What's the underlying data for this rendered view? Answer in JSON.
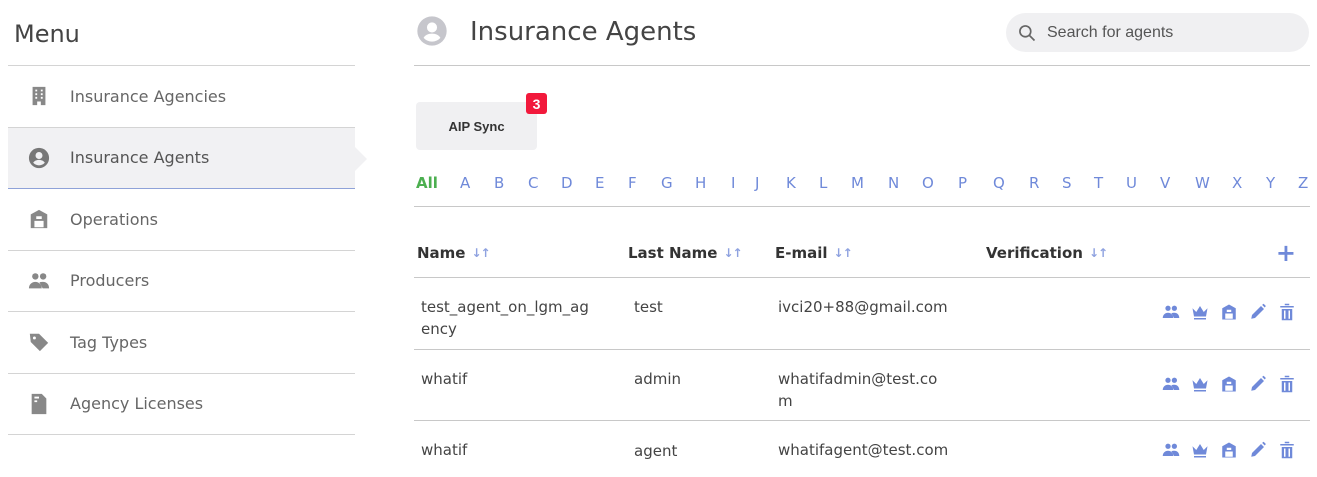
{
  "sidebar": {
    "title": "Menu",
    "items": [
      {
        "label": "Insurance Agencies",
        "icon": "building-icon"
      },
      {
        "label": "Insurance Agents",
        "icon": "user-circle-icon"
      },
      {
        "label": "Operations",
        "icon": "barn-icon"
      },
      {
        "label": "Producers",
        "icon": "users-icon"
      },
      {
        "label": "Tag Types",
        "icon": "tag-icon"
      },
      {
        "label": "Agency Licenses",
        "icon": "license-file-icon"
      }
    ],
    "active_index": 1
  },
  "header": {
    "title": "Insurance Agents",
    "search_placeholder": "Search for agents"
  },
  "sync": {
    "label": "AIP Sync",
    "badge": "3"
  },
  "alphabet": [
    "All",
    "A",
    "B",
    "C",
    "D",
    "E",
    "F",
    "G",
    "H",
    "I",
    "J",
    "K",
    "L",
    "M",
    "N",
    "O",
    "P",
    "Q",
    "R",
    "S",
    "T",
    "U",
    "V",
    "W",
    "X",
    "Y",
    "Z"
  ],
  "table": {
    "columns": [
      "Name",
      "Last Name",
      "E-mail",
      "Verification"
    ],
    "add_label": "+",
    "rows": [
      {
        "name": "test_agent_on_lgm_ag",
        "name2": "ency",
        "last_name": "test",
        "email": "ivci20+88@gmail.com",
        "email2": "",
        "verification": ""
      },
      {
        "name": "whatif",
        "name2": "",
        "last_name": "admin",
        "email": "whatifadmin@test.co",
        "email2": "m",
        "verification": ""
      },
      {
        "name": "whatif",
        "name2": "",
        "last_name": "agent",
        "email": "whatifagent@test.com",
        "email2": "",
        "verification": ""
      }
    ],
    "row_actions": [
      "producers-icon",
      "crown-icon",
      "barn-icon",
      "edit-icon",
      "delete-icon"
    ]
  },
  "colors": {
    "accent": "#6f89d9",
    "active_letter": "#4caf50",
    "badge": "#f2193c",
    "active_bg": "#f1f1f3"
  }
}
